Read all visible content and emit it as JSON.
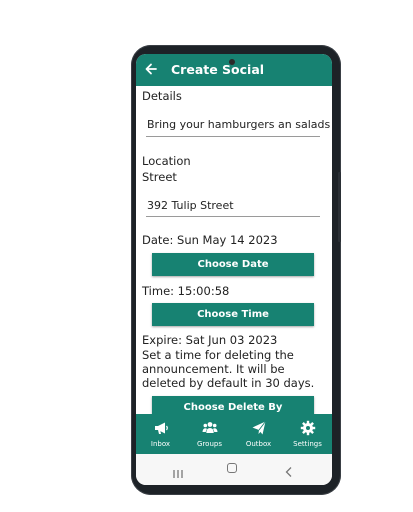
{
  "app": {
    "title": "Create Social"
  },
  "form": {
    "details_label": "Details",
    "details_value": "Bring your hamburgers an salads",
    "location_label": "Location",
    "street_label": "Street",
    "street_value": "392 Tulip Street",
    "date_text": "Date: Sun May 14 2023",
    "choose_date_label": "Choose Date",
    "time_text": "Time: 15:00:58",
    "choose_time_label": "Choose Time",
    "expire_text": "Expire: Sat Jun 03 2023",
    "expire_note": "Set a time for deleting the announcement. It will be deleted by default in 30 days.",
    "choose_delete_label": "Choose Delete By"
  },
  "bottom_nav": {
    "items": [
      {
        "label": "Inbox",
        "icon": "megaphone-icon"
      },
      {
        "label": "Groups",
        "icon": "people-icon"
      },
      {
        "label": "Outbox",
        "icon": "send-icon"
      },
      {
        "label": "Settings",
        "icon": "gear-icon"
      }
    ]
  },
  "colors": {
    "accent": "#178272",
    "text": "#222222"
  }
}
